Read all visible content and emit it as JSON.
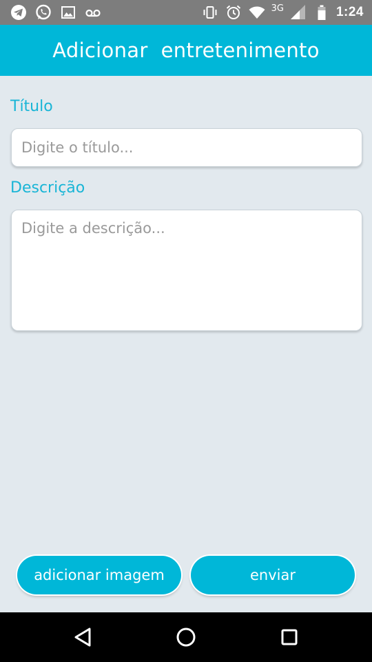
{
  "status_bar": {
    "left_icons": [
      "telegram-icon",
      "whatsapp-icon",
      "image-icon",
      "voicemail-icon"
    ],
    "right_icons": [
      "vibrate-icon",
      "alarm-icon",
      "wifi-icon",
      "signal-icon",
      "battery-icon"
    ],
    "network": "3G",
    "time": "1:24"
  },
  "app_bar": {
    "title": "Adicionar  entretenimento"
  },
  "form": {
    "title_label": "Título",
    "title_placeholder": "Digite o título...",
    "title_value": "",
    "description_label": "Descrição",
    "description_placeholder": "Digite a descrição...",
    "description_value": ""
  },
  "actions": {
    "add_image_label": "adicionar imagem",
    "send_label": "enviar"
  },
  "nav_bar": {
    "icons": [
      "back-icon",
      "home-icon",
      "recents-icon"
    ]
  },
  "colors": {
    "accent": "#00b7d8",
    "label": "#19b5d6",
    "background": "#e2e9ee",
    "status_bar": "#7d7d7d"
  }
}
